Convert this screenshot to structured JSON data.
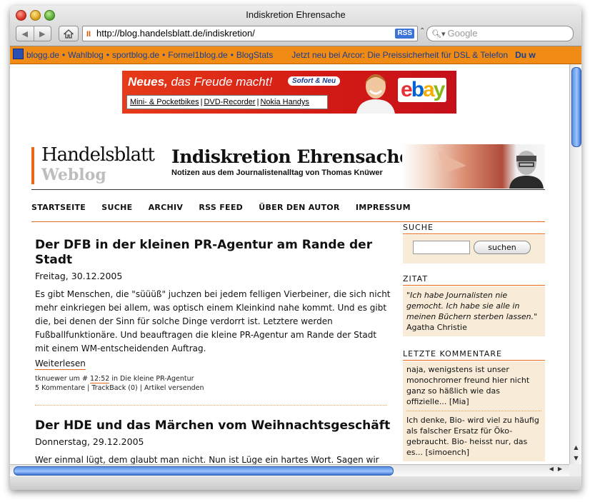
{
  "window": {
    "title": "Indiskretion Ehrensache"
  },
  "toolbar": {
    "url": "http://blog.handelsblatt.de/indiskretion/",
    "rss_label": "RSS",
    "search_placeholder": "Google"
  },
  "bookmarks": {
    "items": [
      "blogg.de",
      "Wahlblog",
      "sportblog.de",
      "Formel1blog.de",
      "BlogStats"
    ],
    "separator": "•",
    "arcor": "Jetzt neu bei Arcor: Die Preissicherheit für DSL & Telefon",
    "last": "Du w"
  },
  "ad": {
    "headline_bold": "Neues,",
    "headline_rest": " das Freude macht!",
    "badge": "Sofort & Neu",
    "links": [
      "Mini- & Pocketbikes",
      "DVD-Recorder",
      "Nokia Handys"
    ],
    "brand": "ebay",
    "colors": {
      "e": "#e53238",
      "b": "#0064d2",
      "a": "#f5af02",
      "y": "#86b817"
    }
  },
  "masthead": {
    "brand": "Handelsblatt",
    "weblog": "Weblog",
    "title": "Indiskretion Ehrensache",
    "subtitle": "Notizen aus dem Journalistenalltag von Thomas Knüwer"
  },
  "nav": [
    "STARTSEITE",
    "SUCHE",
    "ARCHIV",
    "RSS FEED",
    "ÜBER DEN AUTOR",
    "IMPRESSUM"
  ],
  "posts": [
    {
      "title": "Der DFB in der kleinen PR-Agentur am Rande der Stadt",
      "date": "Freitag, 30.12.2005",
      "body": "Es gibt Menschen, die \"süüüß\" juchzen bei jedem felligen Vierbeiner, die sich nicht mehr einkriegen bei allem, was optisch einem Kleinkind nahe kommt. Und es gibt die, bei denen der Sinn für solche Dinge verdorrt ist. Letztere werden Fußballfunktionäre. Und beauftragen die kleine PR-Agentur am Rande der Stadt mit einem WM-entscheidenden Auftrag.",
      "more": "Weiterlesen",
      "meta_prefix": "tknuewer um # ",
      "meta_time": "12:52",
      "meta_suffix": " in Die kleine PR-Agentur",
      "meta_line2": "5 Kommentare | TrackBack (0) | Artikel versenden"
    },
    {
      "title": "Der HDE und das Märchen vom Weihnachtsgeschäft",
      "date": "Donnerstag, 29.12.2005",
      "body": "Wer einmal lügt, dem glaubt man nicht. Nun ist Lüge ein hartes Wort. Sagen wir"
    }
  ],
  "sidebar": {
    "search_head": "SUCHE",
    "search_button": "suchen",
    "quote_head": "ZITAT",
    "quote_text": "\"Ich habe Journalisten nie gemocht. Ich habe sie alle in meinen Büchern sterben lassen.\"",
    "quote_author": "Agatha Christie",
    "comments_head": "LETZTE KOMMENTARE",
    "comments": [
      "naja, wenigstens ist unser monochromer freund hier nicht ganz so häßlich wie das offizielle... [Mia]",
      "Ich denke, Bio- wird viel zu häufig als falscher Ersatz für Öko- gebraucht. Bio- heisst nur, das es... [simoench]"
    ]
  },
  "colors": {
    "accent": "#e8681c",
    "sidebar_bg": "#f8ecd9",
    "bookmark_bar": "#f08b16",
    "scroll": "#5b8fe0"
  }
}
